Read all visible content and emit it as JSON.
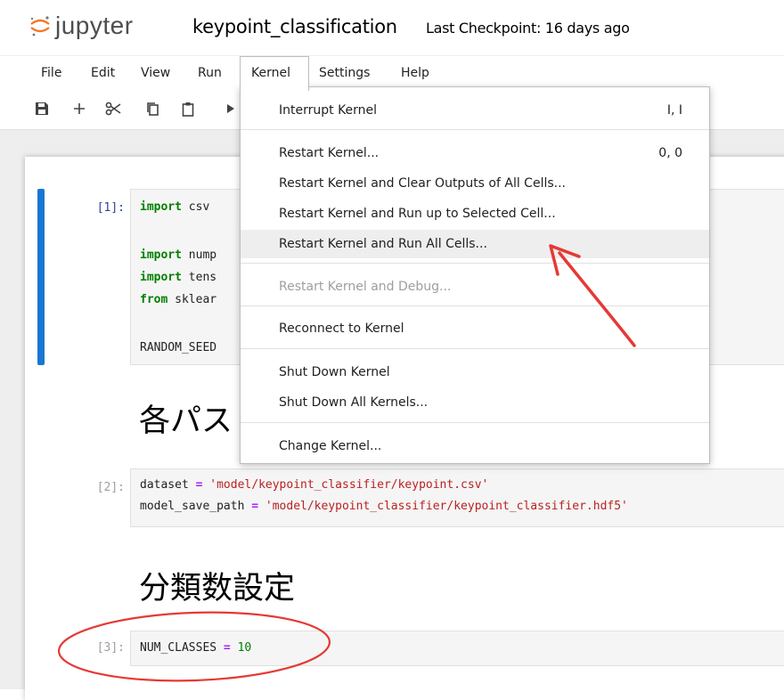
{
  "header": {
    "logo_text": "jupyter",
    "notebook_title": "keypoint_classification",
    "checkpoint": "Last Checkpoint: 16 days ago"
  },
  "menubar": {
    "items": [
      {
        "label": "File"
      },
      {
        "label": "Edit"
      },
      {
        "label": "View"
      },
      {
        "label": "Run"
      },
      {
        "label": "Kernel"
      },
      {
        "label": "Settings"
      },
      {
        "label": "Help"
      }
    ],
    "active": "Kernel"
  },
  "toolbar": {
    "buttons": [
      "save-icon",
      "add-cell-icon",
      "cut-icon",
      "copy-icon",
      "paste-icon",
      "run-icon"
    ]
  },
  "kernel_menu": {
    "interrupt": {
      "label": "Interrupt Kernel",
      "shortcut": "I, I"
    },
    "restart": {
      "label": "Restart Kernel...",
      "shortcut": "0, 0"
    },
    "restart_clear": {
      "label": "Restart Kernel and Clear Outputs of All Cells..."
    },
    "restart_run_selected": {
      "label": "Restart Kernel and Run up to Selected Cell..."
    },
    "restart_run_all": {
      "label": "Restart Kernel and Run All Cells..."
    },
    "restart_debug": {
      "label": "Restart Kernel and Debug..."
    },
    "reconnect": {
      "label": "Reconnect to Kernel"
    },
    "shutdown": {
      "label": "Shut Down Kernel"
    },
    "shutdown_all": {
      "label": "Shut Down All Kernels..."
    },
    "change": {
      "label": "Change Kernel..."
    }
  },
  "cells": {
    "c1": {
      "prompt": "[1]:",
      "l1_kw": "import",
      "l1_rest": " csv",
      "l2_kw": "import",
      "l2_rest": " nump",
      "l3_kw": "import",
      "l3_rest": " tens",
      "l4_kw": "from",
      "l4_rest": " sklear",
      "l5": "RANDOM_SEED"
    },
    "heading1": "各パス",
    "c2": {
      "prompt": "[2]:",
      "l1_var": "dataset",
      "l1_op": "=",
      "l1_str": "'model/keypoint_classifier/keypoint.csv'",
      "l2_var": "model_save_path",
      "l2_op": "=",
      "l2_str": "'model/keypoint_classifier/keypoint_classifier.hdf5'"
    },
    "heading2": "分類数設定",
    "c3": {
      "prompt": "[3]:",
      "var": "NUM_CLASSES",
      "op": "=",
      "num": "10"
    }
  },
  "colors": {
    "accent": "#1976d2",
    "annotation": "#e53935",
    "highlight": "#eeeeee"
  }
}
